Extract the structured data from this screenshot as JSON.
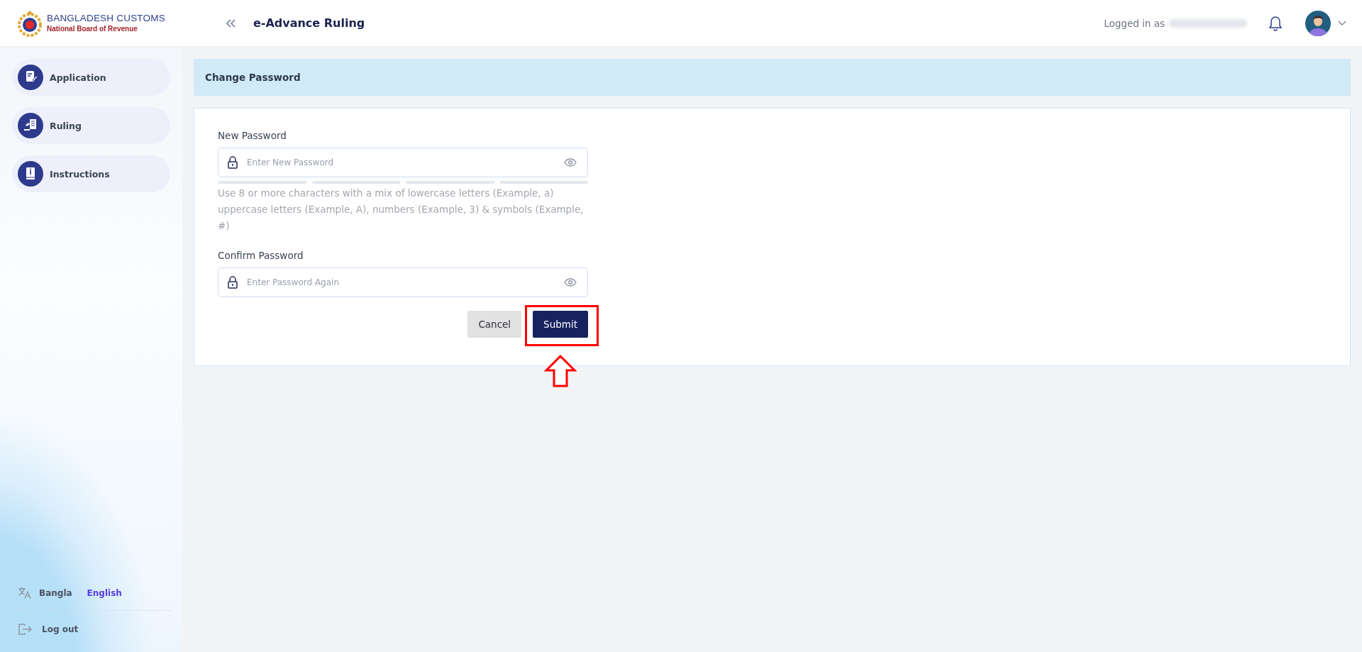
{
  "header": {
    "logo_title": "BANGLADESH CUSTOMS",
    "logo_subtitle": "National Board of Revenue",
    "app_title": "e-Advance Ruling",
    "logged_in_label": "Logged in as"
  },
  "sidebar": {
    "items": [
      {
        "label": "Application",
        "kind": "application"
      },
      {
        "label": "Ruling",
        "kind": "ruling"
      },
      {
        "label": "Instructions",
        "kind": "instructions"
      }
    ],
    "languages": [
      {
        "label": "Bangla",
        "selected": false
      },
      {
        "label": "English",
        "selected": true
      }
    ],
    "logout": "Log out"
  },
  "page": {
    "title": "Change Password",
    "fields": [
      {
        "label": "New Password",
        "placeholder": "Enter New Password",
        "strength_meter": true,
        "hint": "Use 8 or more characters with a mix of lowercase letters (Example, a) uppercase letters (Example, A), numbers (Example, 3) & symbols (Example, #)"
      },
      {
        "label": "Confirm Password",
        "placeholder": "Enter Password Again"
      }
    ],
    "buttons": [
      {
        "label": "Cancel",
        "kind": "secondary",
        "highlighted": false
      },
      {
        "label": "Submit",
        "kind": "primary",
        "highlighted": true
      }
    ]
  }
}
